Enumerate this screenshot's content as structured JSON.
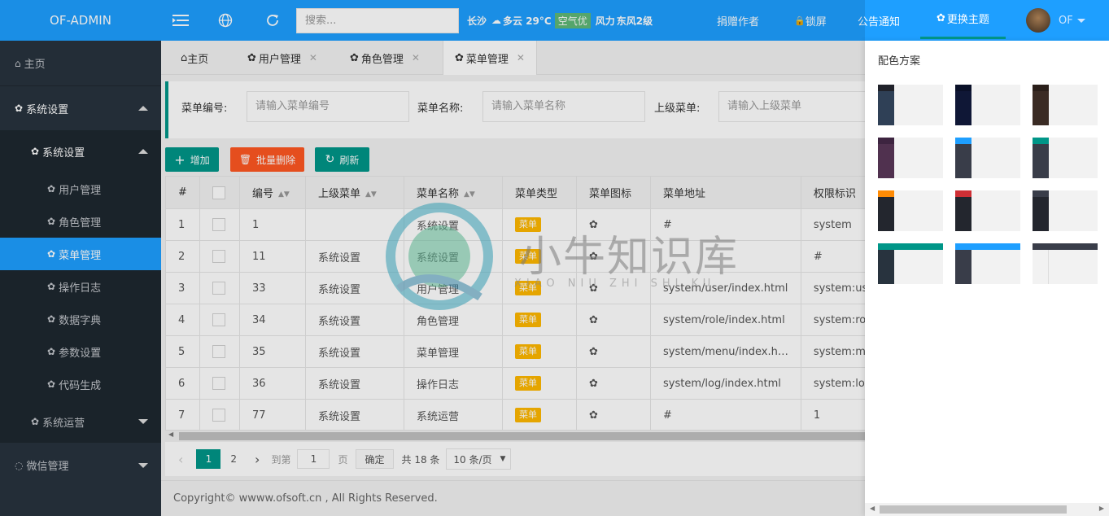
{
  "app": {
    "title": "OF-ADMIN"
  },
  "header": {
    "search_placeholder": "搜索...",
    "city": "长沙",
    "weather": "多云 29°C",
    "air_quality": "空气优",
    "wind_label": "风力",
    "wind_value": "东风2级",
    "donate": "捐赠作者",
    "lock": "锁屏",
    "notice": "公告通知",
    "theme": "更换主题",
    "user": "OF"
  },
  "sidebar": {
    "home": "主页",
    "system_settings": "系统设置",
    "sub_system_settings": "系统设置",
    "items": [
      "用户管理",
      "角色管理",
      "菜单管理",
      "操作日志",
      "数据字典",
      "参数设置",
      "代码生成"
    ],
    "system_ops": "系统运营",
    "wechat": "微信管理"
  },
  "tabs": [
    {
      "label": "主页"
    },
    {
      "label": "用户管理"
    },
    {
      "label": "角色管理"
    },
    {
      "label": "菜单管理"
    }
  ],
  "filter": {
    "menu_no_label": "菜单编号:",
    "menu_no_placeholder": "请输入菜单编号",
    "menu_name_label": "菜单名称:",
    "menu_name_placeholder": "请输入菜单名称",
    "parent_label": "上级菜单:",
    "parent_placeholder": "请输入上级菜单"
  },
  "toolbar": {
    "add": "增加",
    "batch_delete": "批量删除",
    "refresh": "刷新"
  },
  "table": {
    "headers": [
      "#",
      "",
      "编号",
      "上级菜单",
      "菜单名称",
      "菜单类型",
      "菜单图标",
      "菜单地址",
      "权限标识"
    ],
    "rows": [
      {
        "idx": "1",
        "id": "1",
        "parent": "",
        "name": "系统设置",
        "type": "菜单",
        "url": "#",
        "perm": "system"
      },
      {
        "idx": "2",
        "id": "11",
        "parent": "系统设置",
        "name": "系统设置",
        "type": "菜单",
        "url": "",
        "perm": "#"
      },
      {
        "idx": "3",
        "id": "33",
        "parent": "系统设置",
        "name": "用户管理",
        "type": "菜单",
        "url": "system/user/index.html",
        "perm": "system:user"
      },
      {
        "idx": "4",
        "id": "34",
        "parent": "系统设置",
        "name": "角色管理",
        "type": "菜单",
        "url": "system/role/index.html",
        "perm": "system:role"
      },
      {
        "idx": "5",
        "id": "35",
        "parent": "系统设置",
        "name": "菜单管理",
        "type": "菜单",
        "url": "system/menu/index.h…",
        "perm": "system:menu"
      },
      {
        "idx": "6",
        "id": "36",
        "parent": "系统设置",
        "name": "操作日志",
        "type": "菜单",
        "url": "system/log/index.html",
        "perm": "system:log"
      },
      {
        "idx": "7",
        "id": "77",
        "parent": "系统设置",
        "name": "系统运营",
        "type": "菜单",
        "url": "#",
        "perm": "1"
      }
    ]
  },
  "pager": {
    "pages": [
      "1",
      "2"
    ],
    "goto_label": "到第",
    "goto_value": "1",
    "page_unit": "页",
    "confirm": "确定",
    "total": "共 18 条",
    "page_size": "10 条/页"
  },
  "footer": {
    "copyright": "Copyright© wwww.ofsoft.cn , All Rights Reserved."
  },
  "theme_panel": {
    "title": "配色方案"
  },
  "watermark": {
    "text": "小牛知识库",
    "subtext": "XIAO NIU ZHI SHI KU"
  },
  "colors": {
    "header": "#1E9FFF",
    "sidebar": "#28333E",
    "active": "#1E9FFF",
    "primary": "#009688",
    "danger": "#FF5722",
    "badge": "#FFB800"
  }
}
